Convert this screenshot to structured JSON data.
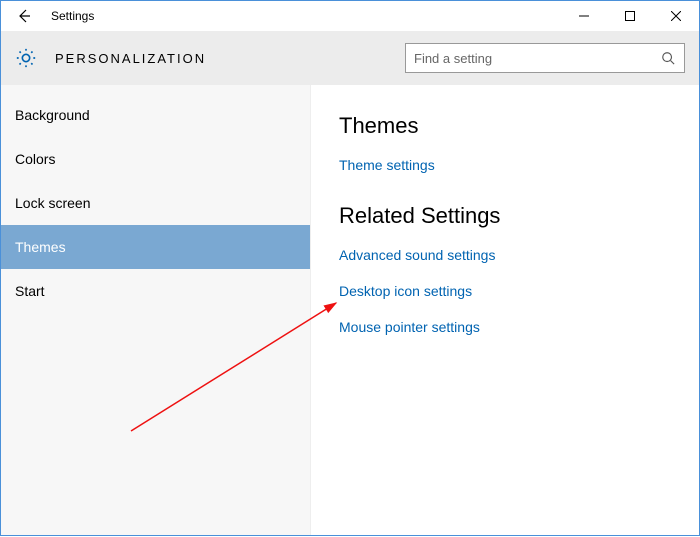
{
  "window": {
    "title": "Settings"
  },
  "header": {
    "category": "PERSONALIZATION",
    "search_placeholder": "Find a setting"
  },
  "sidebar": {
    "items": [
      {
        "label": "Background",
        "selected": false
      },
      {
        "label": "Colors",
        "selected": false
      },
      {
        "label": "Lock screen",
        "selected": false
      },
      {
        "label": "Themes",
        "selected": true
      },
      {
        "label": "Start",
        "selected": false
      }
    ]
  },
  "content": {
    "section1_title": "Themes",
    "theme_settings_link": "Theme settings",
    "section2_title": "Related Settings",
    "link_advanced_sound": "Advanced sound settings",
    "link_desktop_icon": "Desktop icon settings",
    "link_mouse_pointer": "Mouse pointer settings"
  }
}
